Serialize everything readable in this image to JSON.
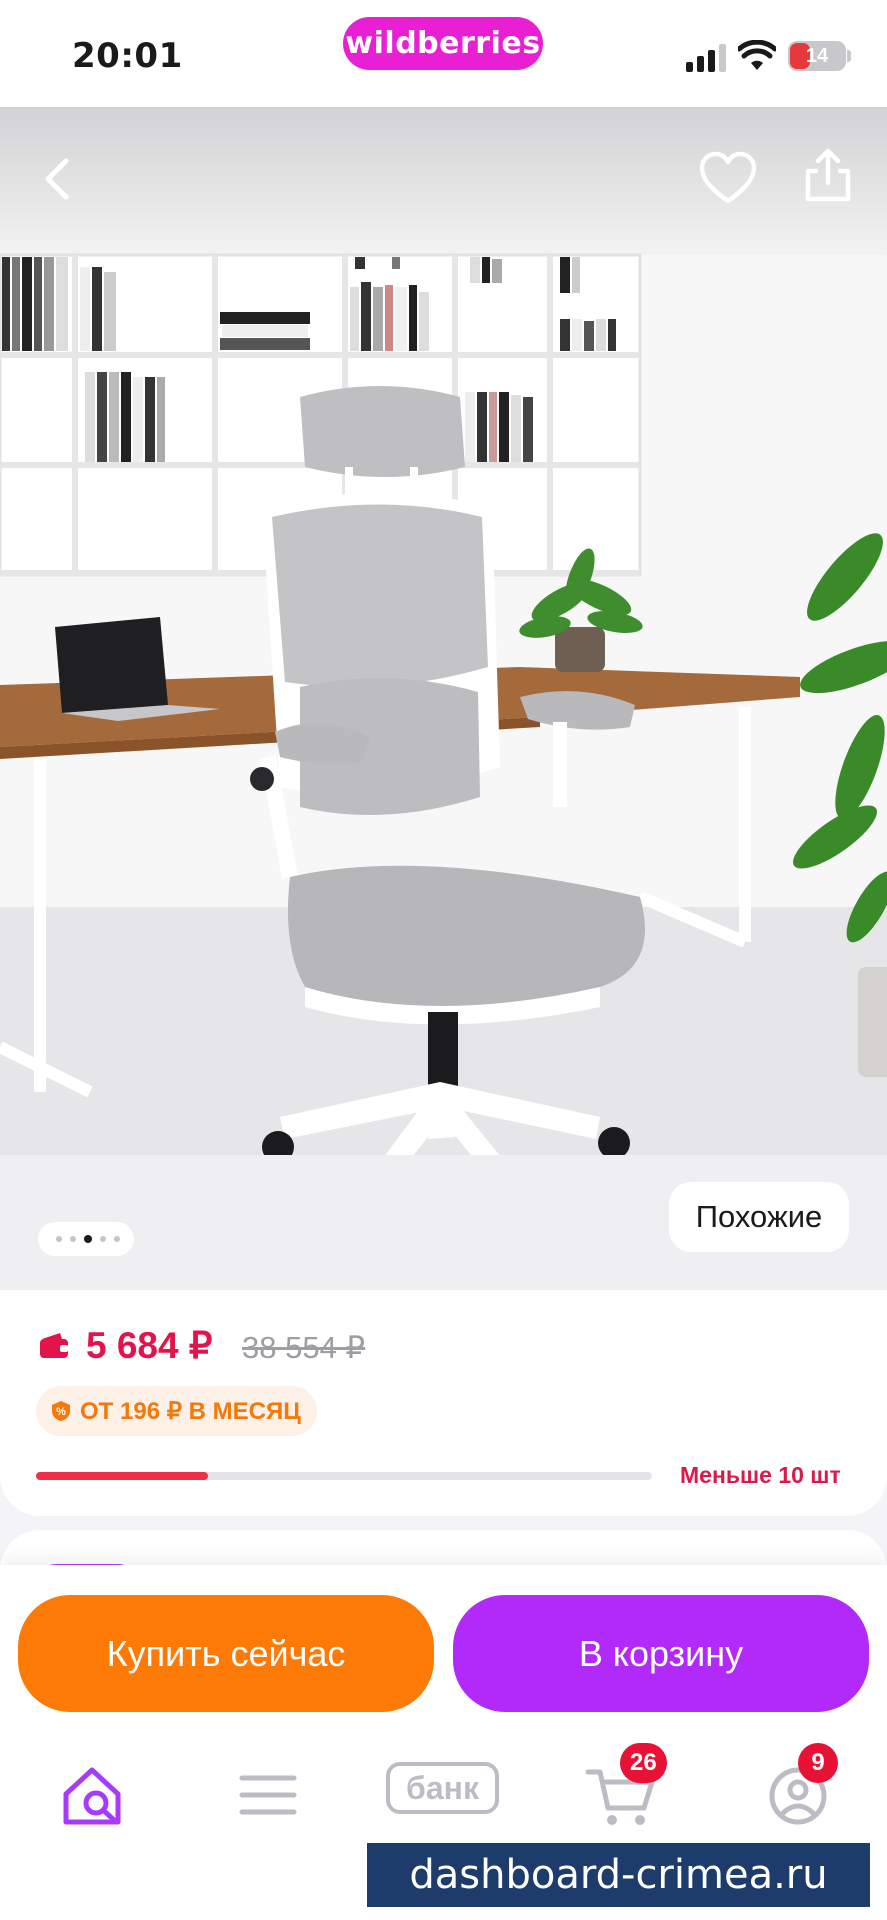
{
  "status_bar": {
    "time": "20:01",
    "battery": "14"
  },
  "brand": {
    "logo_text": "wildberries"
  },
  "gallery": {
    "similar_label": "Похожие",
    "page_count": 5,
    "active_page": 3
  },
  "product": {
    "price": "5 684 ₽",
    "old_price": "38 554 ₽",
    "installment": "ОТ 196 ₽ В МЕСЯЦ",
    "stock_label": "Меньше 10 шт",
    "stock_level": 0.28
  },
  "actions": {
    "buy_now": "Купить сейчас",
    "add_to_cart": "В корзину"
  },
  "tabbar": {
    "bank_label": "банк",
    "cart_badge": "26",
    "profile_badge": "9"
  },
  "watermark": "dashboard-crimea.ru",
  "colors": {
    "brand": "#e91fd4",
    "price": "#e3134c",
    "buy": "#fe7a06",
    "cart": "#b22af9",
    "accent": "#a73afd"
  },
  "icons": [
    "back-icon",
    "heart-icon",
    "share-icon",
    "wallet-icon",
    "installment-icon",
    "home-search-icon",
    "catalog-icon",
    "cart-icon",
    "profile-icon"
  ]
}
